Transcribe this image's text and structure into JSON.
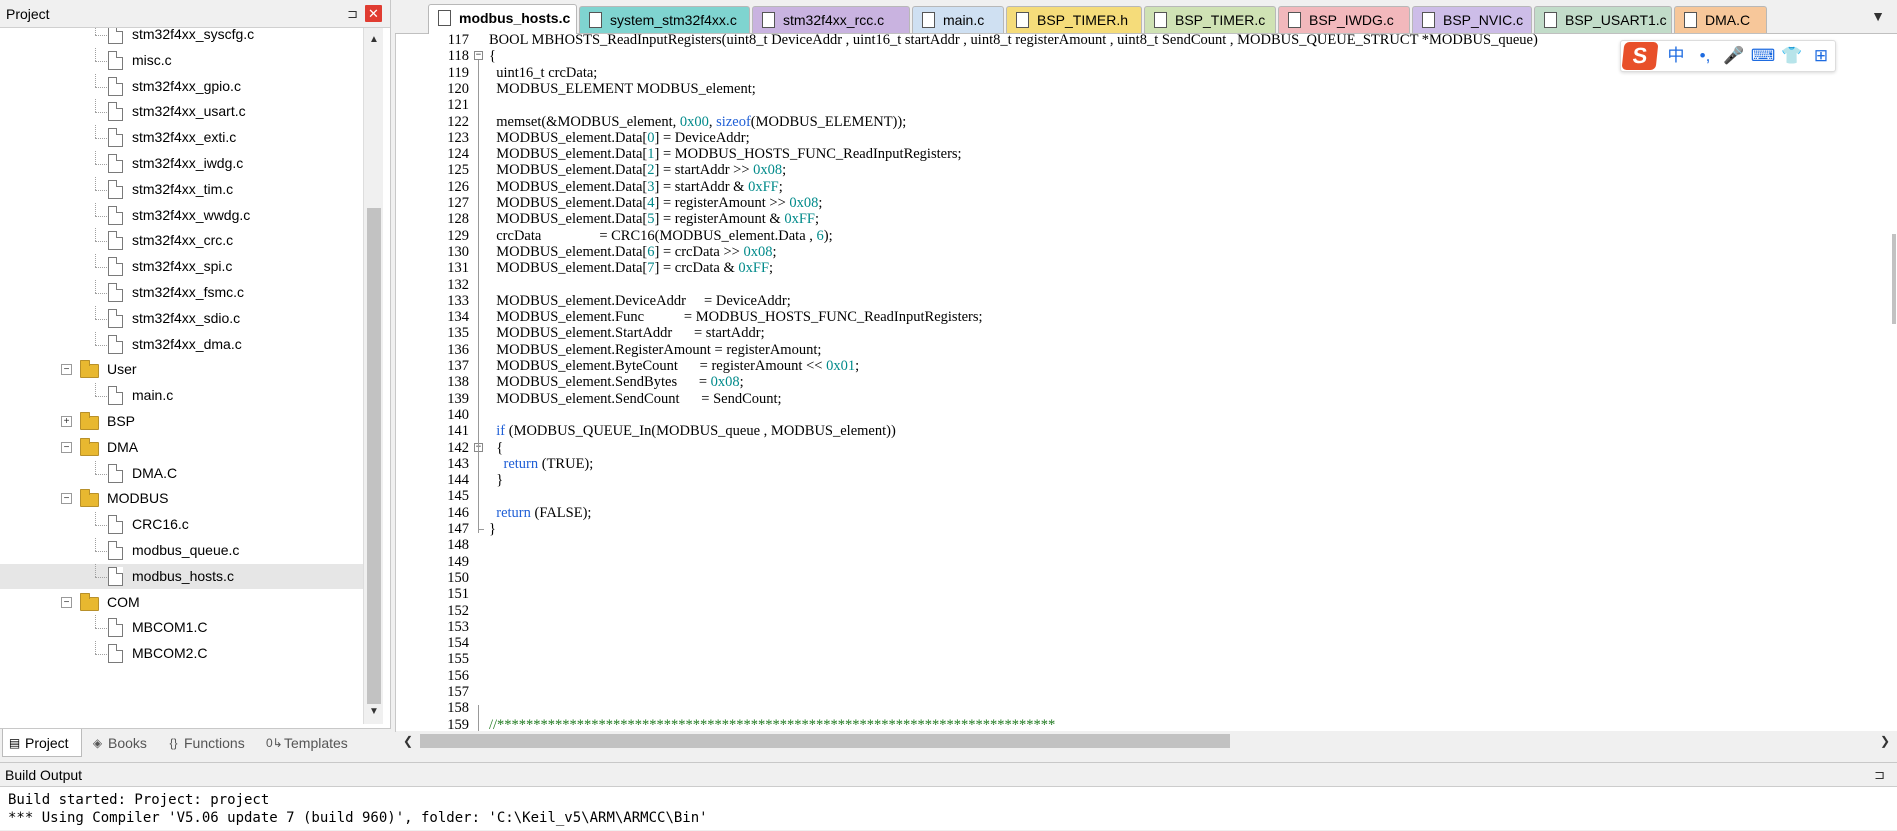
{
  "project_panel": {
    "title": "Project",
    "pin_icon": "⊐",
    "close_icon": "✕",
    "tree": [
      {
        "type": "file",
        "label": "stm32f4xx_syscfg.c",
        "depth": 2
      },
      {
        "type": "file",
        "label": "misc.c",
        "depth": 2
      },
      {
        "type": "file",
        "label": "stm32f4xx_gpio.c",
        "depth": 2
      },
      {
        "type": "file",
        "label": "stm32f4xx_usart.c",
        "depth": 2
      },
      {
        "type": "file",
        "label": "stm32f4xx_exti.c",
        "depth": 2
      },
      {
        "type": "file",
        "label": "stm32f4xx_iwdg.c",
        "depth": 2
      },
      {
        "type": "file",
        "label": "stm32f4xx_tim.c",
        "depth": 2
      },
      {
        "type": "file",
        "label": "stm32f4xx_wwdg.c",
        "depth": 2
      },
      {
        "type": "file",
        "label": "stm32f4xx_crc.c",
        "depth": 2
      },
      {
        "type": "file",
        "label": "stm32f4xx_spi.c",
        "depth": 2
      },
      {
        "type": "file",
        "label": "stm32f4xx_fsmc.c",
        "depth": 2
      },
      {
        "type": "file",
        "label": "stm32f4xx_sdio.c",
        "depth": 2
      },
      {
        "type": "file",
        "label": "stm32f4xx_dma.c",
        "depth": 2
      },
      {
        "type": "folder",
        "label": "User",
        "expanded": true,
        "depth": 1
      },
      {
        "type": "file",
        "label": "main.c",
        "depth": 2
      },
      {
        "type": "folder",
        "label": "BSP",
        "expanded": false,
        "depth": 1
      },
      {
        "type": "folder",
        "label": "DMA",
        "expanded": true,
        "depth": 1
      },
      {
        "type": "file",
        "label": "DMA.C",
        "depth": 2
      },
      {
        "type": "folder",
        "label": "MODBUS",
        "expanded": true,
        "depth": 1
      },
      {
        "type": "file",
        "label": "CRC16.c",
        "depth": 2
      },
      {
        "type": "file",
        "label": "modbus_queue.c",
        "depth": 2
      },
      {
        "type": "file",
        "label": "modbus_hosts.c",
        "depth": 2,
        "selected": true
      },
      {
        "type": "folder",
        "label": "COM",
        "expanded": true,
        "depth": 1
      },
      {
        "type": "file",
        "label": "MBCOM1.C",
        "depth": 2
      },
      {
        "type": "file",
        "label": "MBCOM2.C",
        "depth": 2
      }
    ],
    "bottom_tabs": [
      {
        "label": "Project",
        "icon": "project-icon",
        "glyph": "▤",
        "active": true
      },
      {
        "label": "Books",
        "icon": "books-icon",
        "glyph": "◈",
        "active": false
      },
      {
        "label": "Functions",
        "icon": "functions-icon",
        "glyph": "{}",
        "active": false
      },
      {
        "label": "Templates",
        "icon": "templates-icon",
        "glyph": "0↳",
        "active": false
      }
    ]
  },
  "file_tabs": [
    {
      "label": "modbus_hosts.c",
      "color": "#ffffff",
      "active": true
    },
    {
      "label": "system_stm32f4xx.c",
      "color": "#7fd4d0",
      "active": false
    },
    {
      "label": "stm32f4xx_rcc.c",
      "color": "#c9b3e0",
      "active": false
    },
    {
      "label": "main.c",
      "color": "#cfe0f2",
      "active": false
    },
    {
      "label": "BSP_TIMER.h",
      "color": "#f5dc7a",
      "active": false
    },
    {
      "label": "BSP_TIMER.c",
      "color": "#cfe2b4",
      "active": false
    },
    {
      "label": "BSP_IWDG.c",
      "color": "#f2b8bc",
      "active": false
    },
    {
      "label": "BSP_NVIC.c",
      "color": "#cdbde8",
      "active": false
    },
    {
      "label": "BSP_USART1.c",
      "color": "#c2dcc9",
      "active": false
    },
    {
      "label": "DMA.C",
      "color": "#f7c79a",
      "active": false
    }
  ],
  "tab_menu_icon": "▼",
  "code_lines": [
    {
      "n": "117",
      "text": "BOOL MBHOSTS_ReadInputRegisters(uint8_t DeviceAddr , uint16_t startAddr , uint8_t registerAmount , uint8_t SendCount , MODBUS_QUEUE_STRUCT *MODBUS_queue)"
    },
    {
      "n": "118",
      "text": "{",
      "fold": "open"
    },
    {
      "n": "119",
      "text": "  uint16_t crcData;"
    },
    {
      "n": "120",
      "text": "  MODBUS_ELEMENT MODBUS_element;"
    },
    {
      "n": "121",
      "text": ""
    },
    {
      "n": "122",
      "text": "  memset(&MODBUS_element, 0x00, sizeof(MODBUS_ELEMENT));"
    },
    {
      "n": "123",
      "text": "  MODBUS_element.Data[0] = DeviceAddr;"
    },
    {
      "n": "124",
      "text": "  MODBUS_element.Data[1] = MODBUS_HOSTS_FUNC_ReadInputRegisters;"
    },
    {
      "n": "125",
      "text": "  MODBUS_element.Data[2] = startAddr >> 0x08;"
    },
    {
      "n": "126",
      "text": "  MODBUS_element.Data[3] = startAddr & 0xFF;"
    },
    {
      "n": "127",
      "text": "  MODBUS_element.Data[4] = registerAmount >> 0x08;"
    },
    {
      "n": "128",
      "text": "  MODBUS_element.Data[5] = registerAmount & 0xFF;"
    },
    {
      "n": "129",
      "text": "  crcData                = CRC16(MODBUS_element.Data , 6);"
    },
    {
      "n": "130",
      "text": "  MODBUS_element.Data[6] = crcData >> 0x08;"
    },
    {
      "n": "131",
      "text": "  MODBUS_element.Data[7] = crcData & 0xFF;"
    },
    {
      "n": "132",
      "text": ""
    },
    {
      "n": "133",
      "text": "  MODBUS_element.DeviceAddr     = DeviceAddr;"
    },
    {
      "n": "134",
      "text": "  MODBUS_element.Func           = MODBUS_HOSTS_FUNC_ReadInputRegisters;"
    },
    {
      "n": "135",
      "text": "  MODBUS_element.StartAddr      = startAddr;"
    },
    {
      "n": "136",
      "text": "  MODBUS_element.RegisterAmount = registerAmount;"
    },
    {
      "n": "137",
      "text": "  MODBUS_element.ByteCount      = registerAmount << 0x01;"
    },
    {
      "n": "138",
      "text": "  MODBUS_element.SendBytes      = 0x08;"
    },
    {
      "n": "139",
      "text": "  MODBUS_element.SendCount      = SendCount;"
    },
    {
      "n": "140",
      "text": ""
    },
    {
      "n": "141",
      "text": "  if (MODBUS_QUEUE_In(MODBUS_queue , MODBUS_element))"
    },
    {
      "n": "142",
      "text": "  {",
      "fold": "open"
    },
    {
      "n": "143",
      "text": "    return (TRUE);"
    },
    {
      "n": "144",
      "text": "  }"
    },
    {
      "n": "145",
      "text": ""
    },
    {
      "n": "146",
      "text": "  return (FALSE);"
    },
    {
      "n": "147",
      "text": "}"
    },
    {
      "n": "148",
      "text": ""
    },
    {
      "n": "149",
      "text": ""
    },
    {
      "n": "150",
      "text": ""
    },
    {
      "n": "151",
      "text": ""
    },
    {
      "n": "152",
      "text": ""
    },
    {
      "n": "153",
      "text": ""
    },
    {
      "n": "154",
      "text": ""
    },
    {
      "n": "155",
      "text": ""
    },
    {
      "n": "156",
      "text": ""
    },
    {
      "n": "157",
      "text": ""
    },
    {
      "n": "158",
      "text": ""
    },
    {
      "n": "159",
      "text": "//*****************************************************************************"
    }
  ],
  "syntax_colors": {
    "keyword": "#1f5fd6",
    "number": "#008a8a",
    "comment": "#1f7a1f",
    "text": "#000000"
  },
  "ime_toolbar": {
    "logo": "S",
    "items": [
      "中",
      "•,",
      "🎤",
      "⌨",
      "👕",
      "⊞"
    ]
  },
  "build_output": {
    "title": "Build Output",
    "pin_icon": "⊐",
    "lines": [
      "Build started: Project: project",
      "*** Using Compiler 'V5.06 update 7 (build 960)', folder: 'C:\\Keil_v5\\ARM\\ARMCC\\Bin'"
    ]
  }
}
